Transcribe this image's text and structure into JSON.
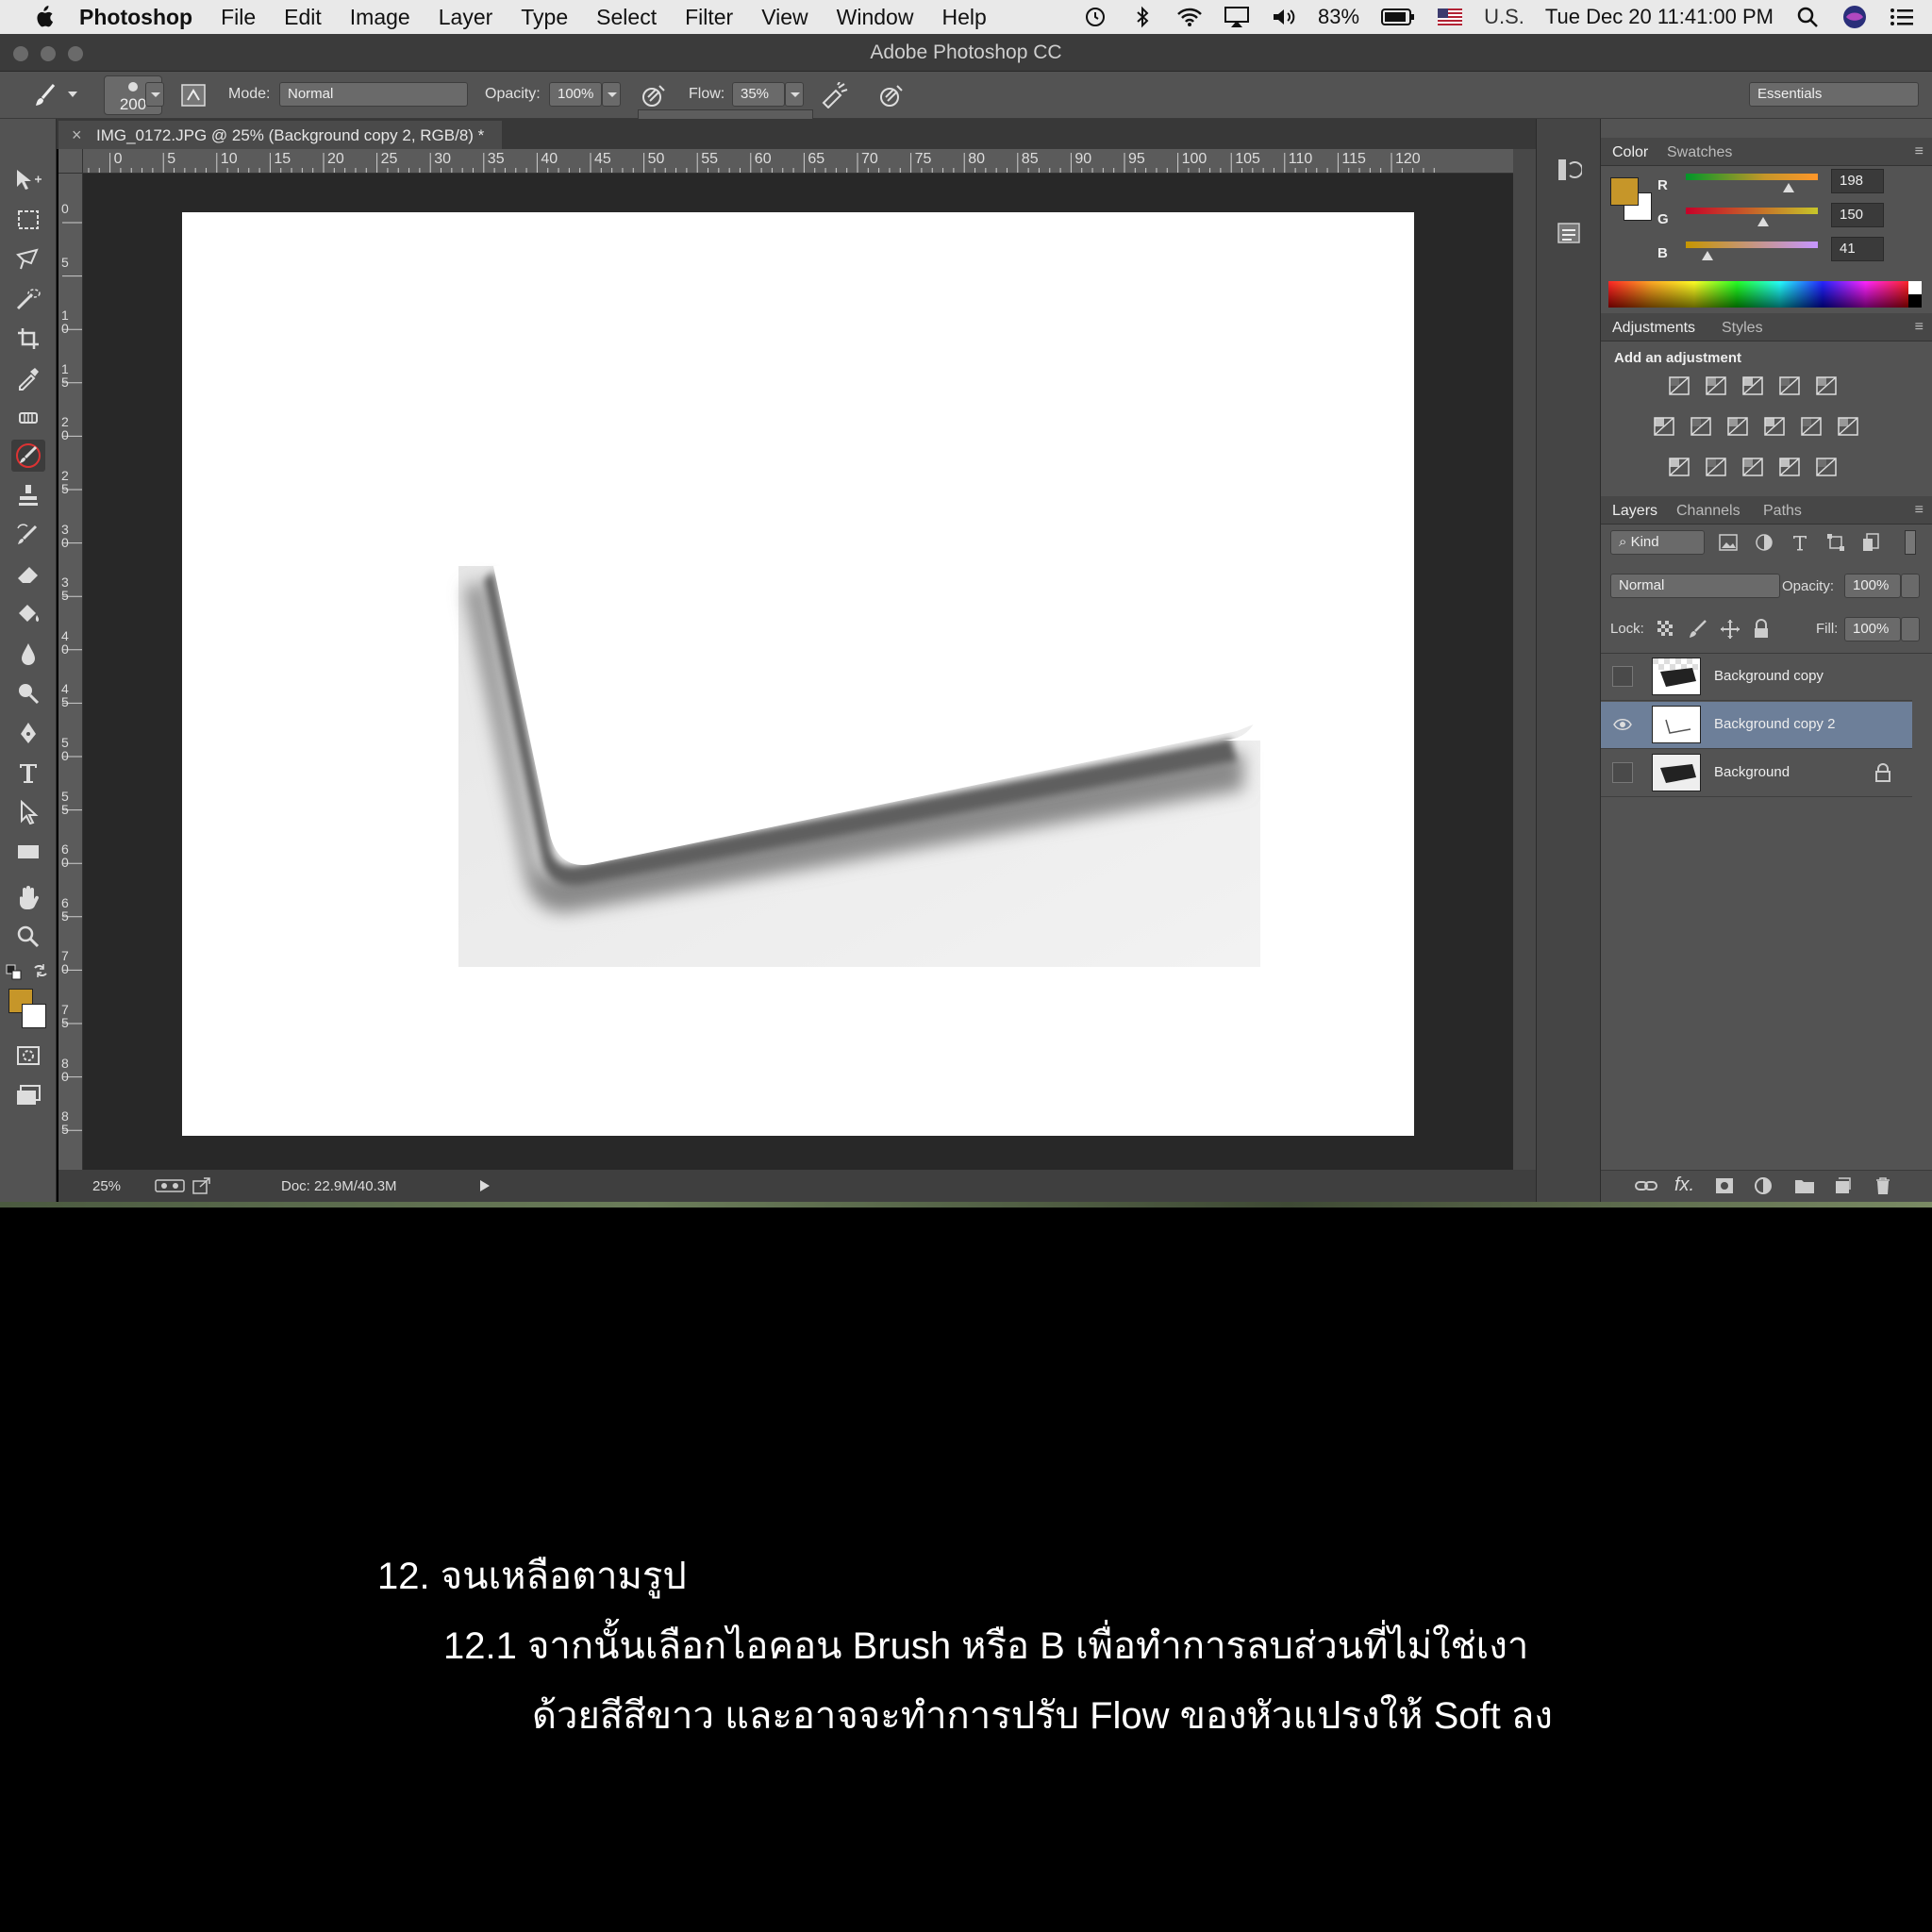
{
  "menubar": {
    "app_name": "Photoshop",
    "items": [
      "File",
      "Edit",
      "Image",
      "Layer",
      "Type",
      "Select",
      "Filter",
      "View",
      "Window",
      "Help"
    ],
    "battery": "83%",
    "input_source": "U.S.",
    "datetime": "Tue Dec 20  11:41:00 PM"
  },
  "window": {
    "title": "Adobe Photoshop CC"
  },
  "options_bar": {
    "brush_size": "200",
    "mode_label": "Mode:",
    "mode_value": "Normal",
    "opacity_label": "Opacity:",
    "opacity_value": "100%",
    "flow_label": "Flow:",
    "flow_value": "35%",
    "flow_slider_level": 0.35,
    "workspace": "Essentials"
  },
  "document": {
    "tab_title": "IMG_0172.JPG @ 25% (Background copy 2, RGB/8) *",
    "ruler_h": [
      "5",
      "0",
      "5",
      "10",
      "15",
      "20",
      "25",
      "30",
      "35",
      "40",
      "45",
      "50",
      "55",
      "60",
      "65",
      "70",
      "75",
      "80",
      "85",
      "90",
      "95",
      "100",
      "105",
      "110",
      "115",
      "120"
    ],
    "ruler_v": [
      "0",
      "5",
      "1\n0",
      "1\n5",
      "2\n0",
      "2\n5",
      "3\n0",
      "3\n5",
      "4\n0",
      "4\n5",
      "5\n0",
      "5\n5",
      "6\n0",
      "6\n5",
      "7\n0",
      "7\n5",
      "8\n0",
      "8\n5"
    ],
    "zoom": "25%",
    "doc_size": "Doc: 22.9M/40.3M"
  },
  "colors": {
    "foreground": "#c69629",
    "background": "#ffffff",
    "selection": "#6d7f99",
    "panel_bg": "#535353"
  },
  "color_panel": {
    "tabs": [
      "Color",
      "Swatches"
    ],
    "channels": [
      {
        "name": "R",
        "value": "198",
        "level": 0.776
      },
      {
        "name": "G",
        "value": "150",
        "level": 0.588
      },
      {
        "name": "B",
        "value": "41",
        "level": 0.161
      }
    ]
  },
  "adjustments_panel": {
    "tabs": [
      "Adjustments",
      "Styles"
    ],
    "heading": "Add an adjustment"
  },
  "layers_panel": {
    "tabs": [
      "Layers",
      "Channels",
      "Paths"
    ],
    "filter_kind": "Kind",
    "blend_mode": "Normal",
    "opacity_label": "Opacity:",
    "opacity_value": "100%",
    "lock_label": "Lock:",
    "fill_label": "Fill:",
    "fill_value": "100%",
    "layers": [
      {
        "name": "Background copy",
        "visible": false,
        "selected": false,
        "locked": false
      },
      {
        "name": "Background copy 2",
        "visible": true,
        "selected": true,
        "locked": false
      },
      {
        "name": "Background",
        "visible": false,
        "selected": false,
        "locked": true
      }
    ]
  },
  "caption": {
    "line1": "12. จนเหลือตามรูป",
    "line2": "12.1 จากนั้นเลือกไอคอน Brush หรือ B เพื่อทำการลบส่วนที่ไม่ใช่เงา",
    "line3": "ด้วยสีสีขาว และอาจจะทำการปรับ Flow ของหัวแปรงให้ Soft ลง"
  }
}
